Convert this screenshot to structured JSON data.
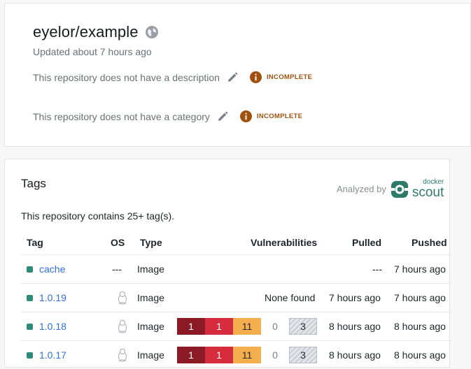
{
  "repo": {
    "title": "eyelor/example",
    "updated": "Updated about 7 hours ago",
    "description_missing": "This repository does not have a description",
    "category_missing": "This repository does not have a category",
    "incomplete_label": "INCOMPLETE"
  },
  "tags": {
    "title": "Tags",
    "analyzed_by": "Analyzed by",
    "logo_small": "docker",
    "logo_large": "scout",
    "count_text": "This repository contains 25+ tag(s).",
    "columns": {
      "tag": "Tag",
      "os": "OS",
      "type": "Type",
      "vulnerabilities": "Vulnerabilities",
      "pulled": "Pulled",
      "pushed": "Pushed"
    },
    "rows": [
      {
        "name": "cache",
        "os": "---",
        "type": "Image",
        "vulns": "",
        "pulled": "---",
        "pushed": "7 hours ago"
      },
      {
        "name": "1.0.19",
        "os": "linux",
        "type": "Image",
        "vulns": "None found",
        "pulled": "7 hours ago",
        "pushed": "7 hours ago"
      },
      {
        "name": "1.0.18",
        "os": "linux",
        "type": "Image",
        "vuln_counts": {
          "critical": "1",
          "high": "1",
          "medium": "11",
          "low": "0",
          "unspecified": "3"
        },
        "pulled": "8 hours ago",
        "pushed": "8 hours ago"
      },
      {
        "name": "1.0.17",
        "os": "linux",
        "type": "Image",
        "vuln_counts": {
          "critical": "1",
          "high": "1",
          "medium": "11",
          "low": "0",
          "unspecified": "3"
        },
        "pulled": "8 hours ago",
        "pushed": "8 hours ago"
      }
    ]
  },
  "colors": {
    "tag_dot": "#2e8a7a",
    "link": "#2f6fdb",
    "incomplete": "#a0500c",
    "critical": "#8b1a25",
    "high": "#d62c3d",
    "medium": "#f4ae4e",
    "scout_brand": "#2d7a6b"
  },
  "icons": {
    "visibility": "globe-icon",
    "edit": "pencil-icon",
    "warning": "info-circle-icon",
    "os": "linux-tux-icon",
    "logo": "docker-scout-logo"
  }
}
